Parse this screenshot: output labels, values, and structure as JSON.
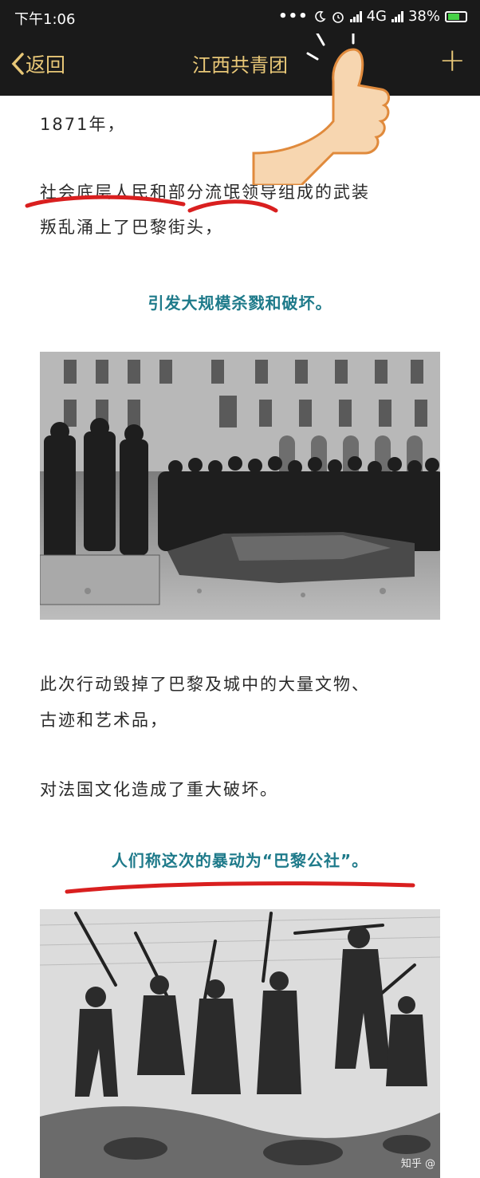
{
  "status_bar": {
    "time": "下午1:06",
    "dots": "•••",
    "network": "4G",
    "battery": "38%"
  },
  "nav": {
    "back_label": "返回",
    "title": "江西共青团",
    "plus_icon": "plus-icon"
  },
  "article": {
    "year_line": "1871年，",
    "para1_line1": "社会底层人民和部分流氓领导组成的武装",
    "para1_line2": "叛乱涌上了巴黎街头，",
    "highlight1": "引发大规模杀戮和破坏。",
    "para2_line1": "此次行动毁掉了巴黎及城中的大量文物、",
    "para2_line2": "古迹和艺术品，",
    "para3": "对法国文化造成了重大破坏。",
    "highlight2": "人们称这次的暴动为“巴黎公社”。",
    "watermark": "知乎 @"
  },
  "colors": {
    "nav_bg": "#1a1a1a",
    "nav_text": "#e8c777",
    "highlight_text": "#1e7a8a",
    "annotation_red": "#d91f1f"
  }
}
